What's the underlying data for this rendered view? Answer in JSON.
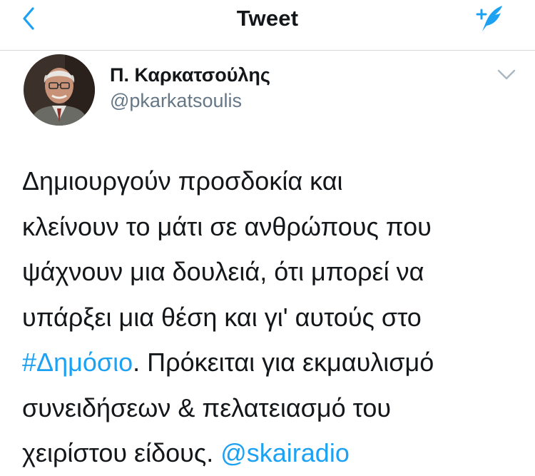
{
  "nav": {
    "title": "Tweet",
    "back_icon": "chevron-left-icon",
    "compose_icon": "compose-tweet-icon",
    "accent_color": "#1da1f2"
  },
  "author": {
    "display_name": "Π. Καρκατσούλης",
    "handle": "@pkarkatsoulis",
    "avatar_icon": "avatar"
  },
  "tweet": {
    "lines": [
      [
        "Δημιουργούν προσδοκία και"
      ],
      [
        "κλείνουν το μάτι σε ανθρώπους που"
      ],
      [
        "ψάχνουν μια δουλειά, ότι μπορεί να"
      ],
      [
        "υπάρξει μια θέση και γι' αυτούς στο"
      ],
      [
        "#Δημόσιο",
        ". Πρόκειται για εκμαυλισμό"
      ],
      [
        "συνειδήσεων & πελατειασμό του"
      ],
      [
        "χειρίστου είδους. ",
        "@skairadio"
      ]
    ],
    "hashtag": "#Δημόσιο",
    "mention": "@skairadio",
    "text_color": "#14171a",
    "link_color": "#1da1f2"
  }
}
